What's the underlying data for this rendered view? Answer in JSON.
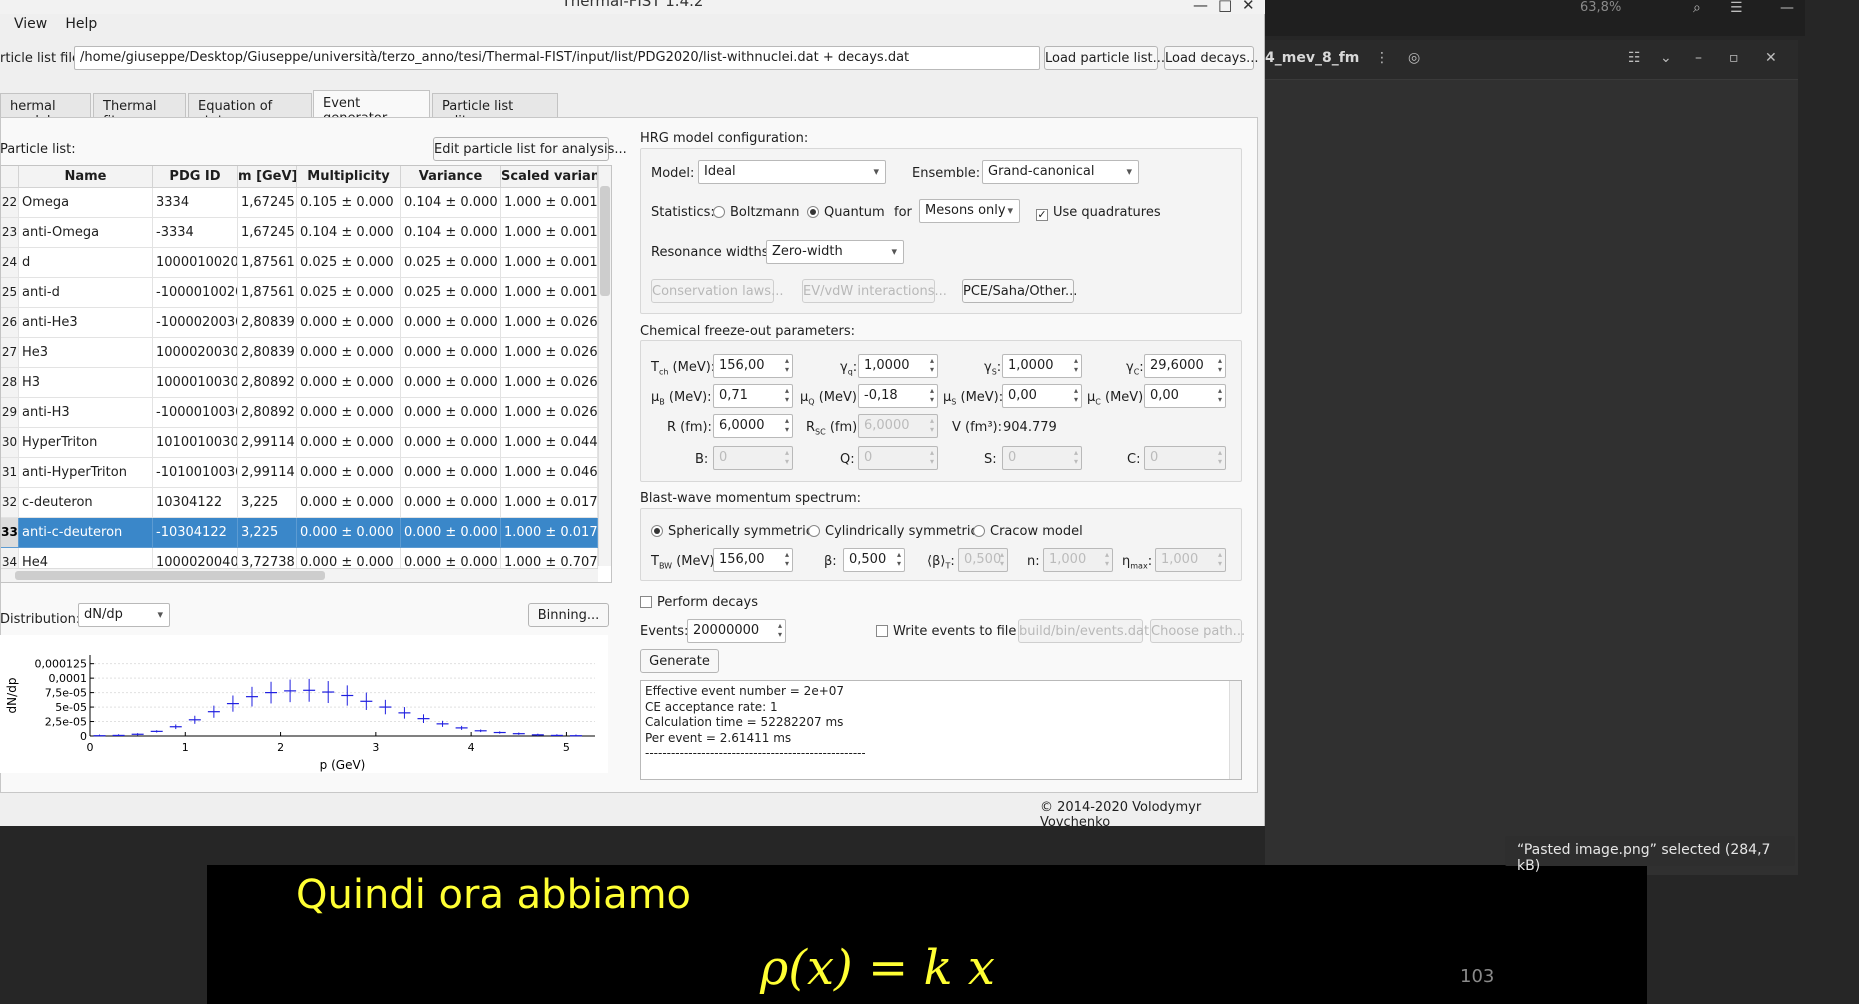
{
  "background": {
    "zoom": "63,8%",
    "file_label": "4_mev_8_fm",
    "toast": "“Pasted image.png” selected  (284,7 kB)",
    "slide_text": "Quindi ora abbiamo",
    "slide_formula": "ρ(x) = k x",
    "slide_page": "103"
  },
  "window": {
    "title": "Thermal-FIST 1.4.2",
    "menu": [
      "View",
      "Help"
    ],
    "particle_list_label": "rticle list file:",
    "particle_list_path": "/home/giuseppe/Desktop/Giuseppe/università/terzo_anno/tesi/Thermal-FIST/input/list/PDG2020/list-withnuclei.dat + decays.dat",
    "load_particle_list": "Load particle list...",
    "load_decays": "Load decays...",
    "tabs": [
      "hermal model",
      "Thermal fits",
      "Equation of state",
      "Event generator",
      "Particle list editor"
    ],
    "active_tab": "Event generator",
    "footer": "© 2014-2020 Volodymyr Vovchenko"
  },
  "particles": {
    "title": "Particle list:",
    "edit_button": "Edit particle list for analysis...",
    "columns": [
      "Name",
      "PDG ID",
      "m [GeV]",
      "Multiplicity",
      "Variance",
      "Scaled varian"
    ],
    "rows": [
      {
        "n": "22",
        "name": "Omega",
        "pdg": "3334",
        "m": "1,67245",
        "mult": "0.105 ± 0.000",
        "var": "0.104 ± 0.000",
        "svar": "1.000 ± 0.001"
      },
      {
        "n": "23",
        "name": "anti-Omega",
        "pdg": "-3334",
        "m": "1,67245",
        "mult": "0.104 ± 0.000",
        "var": "0.104 ± 0.000",
        "svar": "1.000 ± 0.001"
      },
      {
        "n": "24",
        "name": "d",
        "pdg": "1000010020",
        "m": "1,87561",
        "mult": "0.025 ± 0.000",
        "var": "0.025 ± 0.000",
        "svar": "1.000 ± 0.001"
      },
      {
        "n": "25",
        "name": "anti-d",
        "pdg": "-1000010020",
        "m": "1,87561",
        "mult": "0.025 ± 0.000",
        "var": "0.025 ± 0.000",
        "svar": "1.000 ± 0.001"
      },
      {
        "n": "26",
        "name": "anti-He3",
        "pdg": "-1000020030",
        "m": "2,80839",
        "mult": "0.000 ± 0.000",
        "var": "0.000 ± 0.000",
        "svar": "1.000 ± 0.026"
      },
      {
        "n": "27",
        "name": "He3",
        "pdg": "1000020030",
        "m": "2,80839",
        "mult": "0.000 ± 0.000",
        "var": "0.000 ± 0.000",
        "svar": "1.000 ± 0.026"
      },
      {
        "n": "28",
        "name": "H3",
        "pdg": "1000010030",
        "m": "2,80892",
        "mult": "0.000 ± 0.000",
        "var": "0.000 ± 0.000",
        "svar": "1.000 ± 0.026"
      },
      {
        "n": "29",
        "name": "anti-H3",
        "pdg": "-1000010030",
        "m": "2,80892",
        "mult": "0.000 ± 0.000",
        "var": "0.000 ± 0.000",
        "svar": "1.000 ± 0.026"
      },
      {
        "n": "30",
        "name": "HyperTriton",
        "pdg": "1010010030",
        "m": "2,99114",
        "mult": "0.000 ± 0.000",
        "var": "0.000 ± 0.000",
        "svar": "1.000 ± 0.044"
      },
      {
        "n": "31",
        "name": "anti-HyperTriton",
        "pdg": "-1010010030",
        "m": "2,99114",
        "mult": "0.000 ± 0.000",
        "var": "0.000 ± 0.000",
        "svar": "1.000 ± 0.046"
      },
      {
        "n": "32",
        "name": "c-deuteron",
        "pdg": "10304122",
        "m": "3,225",
        "mult": "0.000 ± 0.000",
        "var": "0.000 ± 0.000",
        "svar": "1.000 ± 0.017"
      },
      {
        "n": "33",
        "name": "anti-c-deuteron",
        "pdg": "-10304122",
        "m": "3,225",
        "mult": "0.000 ± 0.000",
        "var": "0.000 ± 0.000",
        "svar": "1.000 ± 0.017",
        "selected": true
      },
      {
        "n": "34",
        "name": "He4",
        "pdg": "1000020040",
        "m": "3,72738",
        "mult": "0.000 ± 0.000",
        "var": "0.000 ± 0.000",
        "svar": "1.000 ± 0.707"
      }
    ],
    "distribution_label": "Distribution:",
    "distribution_value": "dN/dp",
    "binning_button": "Binning..."
  },
  "hrg": {
    "title": "HRG model configuration:",
    "model_label": "Model:",
    "model_value": "Ideal",
    "ensemble_label": "Ensemble:",
    "ensemble_value": "Grand-canonical",
    "statistics_label": "Statistics:",
    "boltzmann": "Boltzmann",
    "quantum": "Quantum",
    "for_label": "for",
    "mesons_only": "Mesons only",
    "use_quadratures": "Use quadratures",
    "resonance_label": "Resonance widths:",
    "resonance_value": "Zero-width",
    "conservation_laws": "Conservation laws...",
    "ev_interactions": "EV/vdW interactions...",
    "pce": "PCE/Saha/Other..."
  },
  "freezeout": {
    "title": "Chemical freeze-out parameters:",
    "Tch_label": "T",
    "Tch_sub": "ch",
    "Tch_unit": " (MeV):",
    "Tch": "156,00",
    "gq_label": "γ",
    "gq_sub": "q",
    "gq": "1,0000",
    "gs_label": "γ",
    "gs_sub": "S",
    "gs": "1,0000",
    "gc_label": "γ",
    "gc_sub": "C",
    "gc": "29,6000",
    "muB_label": "μ",
    "muB_sub": "B",
    "muB": "0,71",
    "muQ_label": "μ",
    "muQ_sub": "Q",
    "muQ": "-0,18",
    "muS_label": "μ",
    "muS_sub": "S",
    "muS": "0,00",
    "muC_label": "μ",
    "muC_sub": "C",
    "muC": "0,00",
    "mev_unit": " (MeV):",
    "R_label": "R (fm):",
    "R": "6,0000",
    "Rsc_label": "R",
    "Rsc_sub": "SC",
    "Rsc_unit": " (fm):",
    "Rsc": "6,0000",
    "V_label": "V (fm³):",
    "V": "904.779",
    "B_label": "B:",
    "B": "0",
    "Q_label": "Q:",
    "Q": "0",
    "S_label": "S:",
    "S": "0",
    "C_label": "C:",
    "C": "0"
  },
  "blastwave": {
    "title": "Blast-wave momentum spectrum:",
    "spherical": "Spherically symmetric",
    "cylindrical": "Cylindrically symmetric",
    "cracow": "Cracow model",
    "Tbw_label": "T",
    "Tbw_sub": "BW",
    "Tbw_unit": " (MeV):",
    "Tbw": "156,00",
    "beta_label": "β:",
    "beta": "0,500",
    "betaT_label": "⟨β⟩",
    "betaT_sub": "T",
    "betaT_unit": ":",
    "betaT": "0,500",
    "n_label": "n:",
    "n": "1,000",
    "eta_label": "η",
    "eta_sub": "max",
    "eta_unit": ":",
    "eta": "1,000"
  },
  "events": {
    "perform_decays": "Perform decays",
    "events_label": "Events:",
    "events_value": "20000000",
    "write_events": "Write events to file",
    "output_path": "build/bin/events.dat",
    "choose_path": "Choose path...",
    "generate": "Generate",
    "log": [
      "Effective event number = 2e+07",
      "CE acceptance rate: 1",
      "Calculation time = 52282207 ms",
      "Per event = 2.61411 ms",
      "--------------------------------------------------------"
    ]
  },
  "chart_data": {
    "type": "scatter",
    "xlabel": "p (GeV)",
    "ylabel": "dN/dp",
    "xlim": [
      0,
      5.3
    ],
    "ylim": [
      0,
      0.00014
    ],
    "xticks": [
      "0",
      "1",
      "2",
      "3",
      "4",
      "5"
    ],
    "yticks": [
      "0",
      "2,5e-05",
      "5e-05",
      "7,5e-05",
      "0,0001",
      "0,000125"
    ],
    "ytick_values": [
      0,
      2.5e-05,
      5e-05,
      7.5e-05,
      0.0001,
      0.000125
    ],
    "color": "#1f1fe0",
    "series": [
      {
        "x": [
          0.1,
          0.3,
          0.5,
          0.7,
          0.9,
          1.1,
          1.3,
          1.5,
          1.7,
          1.9,
          2.1,
          2.3,
          2.5,
          2.7,
          2.9,
          3.1,
          3.3,
          3.5,
          3.7,
          3.9,
          4.1,
          4.3,
          4.5,
          4.7,
          4.9,
          5.1
        ],
        "values": [
          5e-07,
          1e-06,
          3e-06,
          8e-06,
          1.6e-05,
          2.8e-05,
          4.2e-05,
          5.6e-05,
          6.8e-05,
          7.5e-05,
          7.8e-05,
          7.9e-05,
          7.6e-05,
          7e-05,
          6e-05,
          5e-05,
          4e-05,
          3e-05,
          2.1e-05,
          1.4e-05,
          9e-06,
          6e-06,
          4e-06,
          2e-06,
          1e-06,
          5e-07
        ]
      }
    ]
  }
}
